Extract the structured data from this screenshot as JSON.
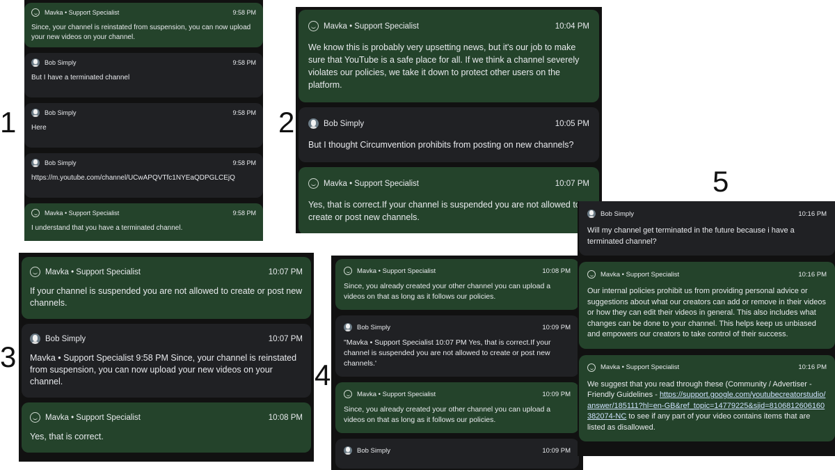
{
  "labels": {
    "n1": "1",
    "n2": "2",
    "n3": "3",
    "n4": "4",
    "n5": "5"
  },
  "panel1": {
    "messages": [
      {
        "sender": "Mavka • Support Specialist",
        "time": "9:58 PM",
        "text": "Since, your channel is reinstated from suspension, you can now upload your new videos on your channel."
      },
      {
        "sender": "Bob Simply",
        "time": "9:58 PM",
        "text": "But I have a terminated channel"
      },
      {
        "sender": "Bob Simply",
        "time": "9:58 PM",
        "text": "Here"
      },
      {
        "sender": "Bob Simply",
        "time": "9:58 PM",
        "text": "https://m.youtube.com/channel/UCwAPQVTfc1NYEaQDPGLCEjQ"
      },
      {
        "sender": "Mavka • Support Specialist",
        "time": "9:58 PM",
        "text": "I understand that you have a terminated channel."
      }
    ]
  },
  "panel2": {
    "messages": [
      {
        "sender": "Mavka • Support Specialist",
        "time": "10:04 PM",
        "text": "We know this is probably very upsetting news, but it's our job to make sure that YouTube is a safe place for all. If we think a channel severely violates our policies, we take it down to protect other users on the platform."
      },
      {
        "sender": "Bob Simply",
        "time": "10:05 PM",
        "text": "But I thought Circumvention prohibits from posting on new channels?"
      },
      {
        "sender": "Mavka • Support Specialist",
        "time": "10:07 PM",
        "text": "Yes, that is correct.If your channel is suspended you are not allowed to create or post new channels."
      }
    ]
  },
  "panel3": {
    "messages": [
      {
        "sender": "Mavka • Support Specialist",
        "time": "10:07 PM",
        "text": "If your channel is suspended you are not allowed to create or post new channels."
      },
      {
        "sender": "Bob Simply",
        "time": "10:07 PM",
        "text": "Mavka • Support Specialist 9:58 PM Since, your channel is reinstated from suspension, you can now upload your new videos on your channel."
      },
      {
        "sender": "Mavka • Support Specialist",
        "time": "10:08 PM",
        "text": "Yes, that is correct."
      }
    ]
  },
  "panel4": {
    "messages": [
      {
        "sender": "Mavka • Support Specialist",
        "time": "10:08 PM",
        "text": "Since, you already created your other channel you can upload a videos on that as long as it follows our policies."
      },
      {
        "sender": "Bob Simply",
        "time": "10:09 PM",
        "text": "\"Mavka • Support Specialist 10:07 PM Yes, that is correct.If your channel is suspended you are not allowed to create or post new channels.'"
      },
      {
        "sender": "Mavka • Support Specialist",
        "time": "10:09 PM",
        "text": "Since, you already created your other channel you can upload a videos on that as long as it follows our policies."
      },
      {
        "sender": "Bob Simply",
        "time": "10:09 PM",
        "text": ""
      }
    ]
  },
  "panel5": {
    "messages": [
      {
        "sender": "Bob Simply",
        "time": "10:16 PM",
        "text": "Will my channel get terminated in the future because i have a terminated channel?"
      },
      {
        "sender": "Mavka • Support Specialist",
        "time": "10:16 PM",
        "text": "Our internal policies prohibit us from providing personal advice or suggestions about what our creators can add or remove in their videos or how they can edit their videos in general. This also includes what changes can be done to your channel. This helps keep us unbiased and empowers our creators to take control of their success."
      },
      {
        "sender": "Mavka • Support Specialist",
        "time": "10:16 PM",
        "text_before": "We suggest that you read through these (Community / Advertiser - Friendly Guidelines - ",
        "link": "https://support.google.com/youtubecreatorstudio/answer/185111?hl=en-GB&ref_topic=14779225&sjid=8106812606160382074-NC",
        "text_after": " to see if any part of your video contains items that are listed as disallowed."
      }
    ]
  },
  "icons": {
    "agent": "smile-face-icon",
    "user": "user-avatar-icon"
  },
  "colors": {
    "agent_bubble": "#24432b",
    "user_bubble": "#202124",
    "panel_bg": "#111111"
  }
}
